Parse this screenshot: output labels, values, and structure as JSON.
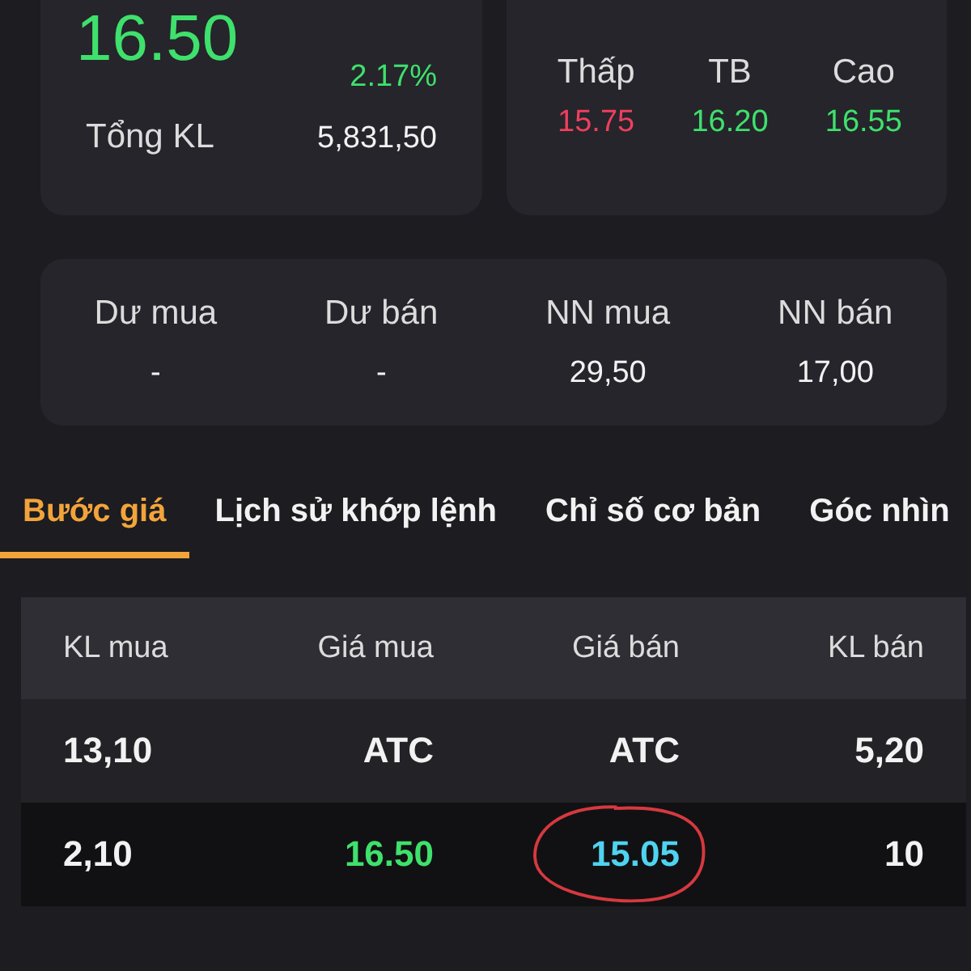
{
  "summary": {
    "price": {
      "text": "16.50",
      "color": "#3fe06c"
    },
    "percent": {
      "text": "2.17%",
      "color": "#3fe06c"
    },
    "total_label": "Tổng KL",
    "total_value": "5,831,50"
  },
  "range": {
    "stats": [
      {
        "label": "Thấp",
        "value": "15.75",
        "color": "#ee3f5e"
      },
      {
        "label": "TB",
        "value": "16.20",
        "color": "#3fe06c"
      },
      {
        "label": "Cao",
        "value": "16.55",
        "color": "#3fe06c"
      }
    ]
  },
  "flows": [
    {
      "label": "Dư mua",
      "value": "-"
    },
    {
      "label": "Dư bán",
      "value": "-"
    },
    {
      "label": "NN mua",
      "value": "29,50"
    },
    {
      "label": "NN bán",
      "value": "17,00"
    }
  ],
  "tabs": [
    {
      "label": "Bước giá",
      "selected": true
    },
    {
      "label": "Lịch sử khớp lệnh",
      "selected": false
    },
    {
      "label": "Chỉ số cơ bản",
      "selected": false
    },
    {
      "label": "Góc nhìn",
      "selected": false
    }
  ],
  "table": {
    "columns": [
      "KL mua",
      "Giá mua",
      "Giá bán",
      "KL bán"
    ],
    "rows": [
      {
        "selected": false,
        "circled": false,
        "cells": [
          {
            "text": "13,10"
          },
          {
            "text": "ATC"
          },
          {
            "text": "ATC"
          },
          {
            "text": "5,20"
          }
        ]
      },
      {
        "selected": true,
        "circled": true,
        "cells": [
          {
            "text": "2,10"
          },
          {
            "text": "16.50",
            "color": "#3fe06c"
          },
          {
            "text": "15.05",
            "color": "#4fd3ef"
          },
          {
            "text": "10"
          }
        ]
      }
    ]
  }
}
